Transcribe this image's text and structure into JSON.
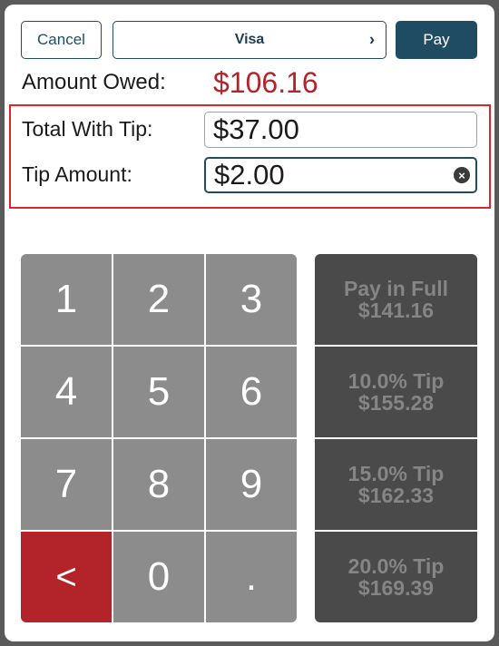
{
  "toolbar": {
    "cancel_label": "Cancel",
    "method_label": "Visa",
    "method_chevron": "›",
    "pay_label": "Pay"
  },
  "amount_owed": {
    "label": "Amount Owed:",
    "value": "$106.16",
    "color": "#b3242a"
  },
  "total_with_tip": {
    "label": "Total With Tip:",
    "value": "$37.00"
  },
  "tip_amount": {
    "label": "Tip Amount:",
    "value": "$2.00",
    "clear_icon": "⊗"
  },
  "keypad": {
    "keys": [
      "1",
      "2",
      "3",
      "4",
      "5",
      "6",
      "7",
      "8",
      "9",
      "<",
      "0",
      "."
    ]
  },
  "quick_pay": [
    {
      "title": "Pay in Full",
      "amount": "$141.16"
    },
    {
      "title": "10.0% Tip",
      "amount": "$155.28"
    },
    {
      "title": "15.0% Tip",
      "amount": "$162.33"
    },
    {
      "title": "20.0% Tip",
      "amount": "$169.39"
    }
  ],
  "colors": {
    "accent": "#1f4c63",
    "alert": "#d2282e",
    "key": "#8c8c8c",
    "quick": "#4a4a4a"
  }
}
